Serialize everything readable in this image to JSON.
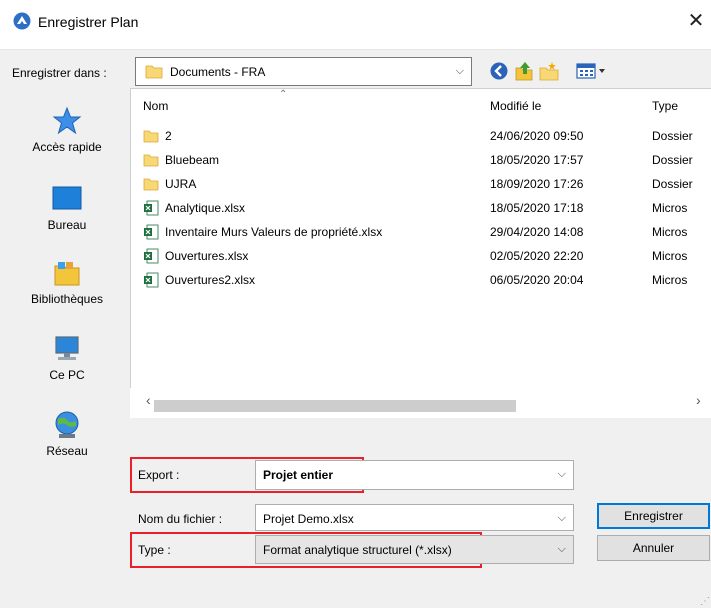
{
  "window": {
    "title": "Enregistrer Plan",
    "close_glyph": "✕"
  },
  "savein": {
    "label": "Enregistrer dans :",
    "value": "Documents - FRA"
  },
  "places": [
    {
      "label": "Accès rapide",
      "icon": "star-icon"
    },
    {
      "label": "Bureau",
      "icon": "desktop-icon"
    },
    {
      "label": "Bibliothèques",
      "icon": "libraries-icon"
    },
    {
      "label": "Ce PC",
      "icon": "computer-icon"
    },
    {
      "label": "Réseau",
      "icon": "network-icon"
    }
  ],
  "columns": {
    "name": "Nom",
    "modified": "Modifié le",
    "type": "Type"
  },
  "files": [
    {
      "name": "2",
      "modified": "24/06/2020 09:50",
      "type": "Dossier",
      "kind": "folder"
    },
    {
      "name": "Bluebeam",
      "modified": "18/05/2020 17:57",
      "type": "Dossier",
      "kind": "folder"
    },
    {
      "name": "UJRA",
      "modified": "18/09/2020 17:26",
      "type": "Dossier",
      "kind": "folder"
    },
    {
      "name": "Analytique.xlsx",
      "modified": "18/05/2020 17:18",
      "type": "Micros",
      "kind": "excel"
    },
    {
      "name": "Inventaire Murs Valeurs de propriété.xlsx",
      "modified": "29/04/2020 14:08",
      "type": "Micros",
      "kind": "excel"
    },
    {
      "name": "Ouvertures.xlsx",
      "modified": "02/05/2020 22:20",
      "type": "Micros",
      "kind": "excel"
    },
    {
      "name": "Ouvertures2.xlsx",
      "modified": "06/05/2020 20:04",
      "type": "Micros",
      "kind": "excel"
    }
  ],
  "form": {
    "export_label": "Export :",
    "export_value": "Projet entier",
    "filename_label": "Nom du fichier :",
    "filename_value": "Projet Demo.xlsx",
    "type_label": "Type :",
    "type_value": "Format analytique structurel (*.xlsx)"
  },
  "buttons": {
    "save": "Enregistrer",
    "cancel": "Annuler"
  },
  "colors": {
    "accent": "#0078d7",
    "highlight": "#e8202a",
    "folder": "#f8d775",
    "excel": "#1d6f42"
  }
}
